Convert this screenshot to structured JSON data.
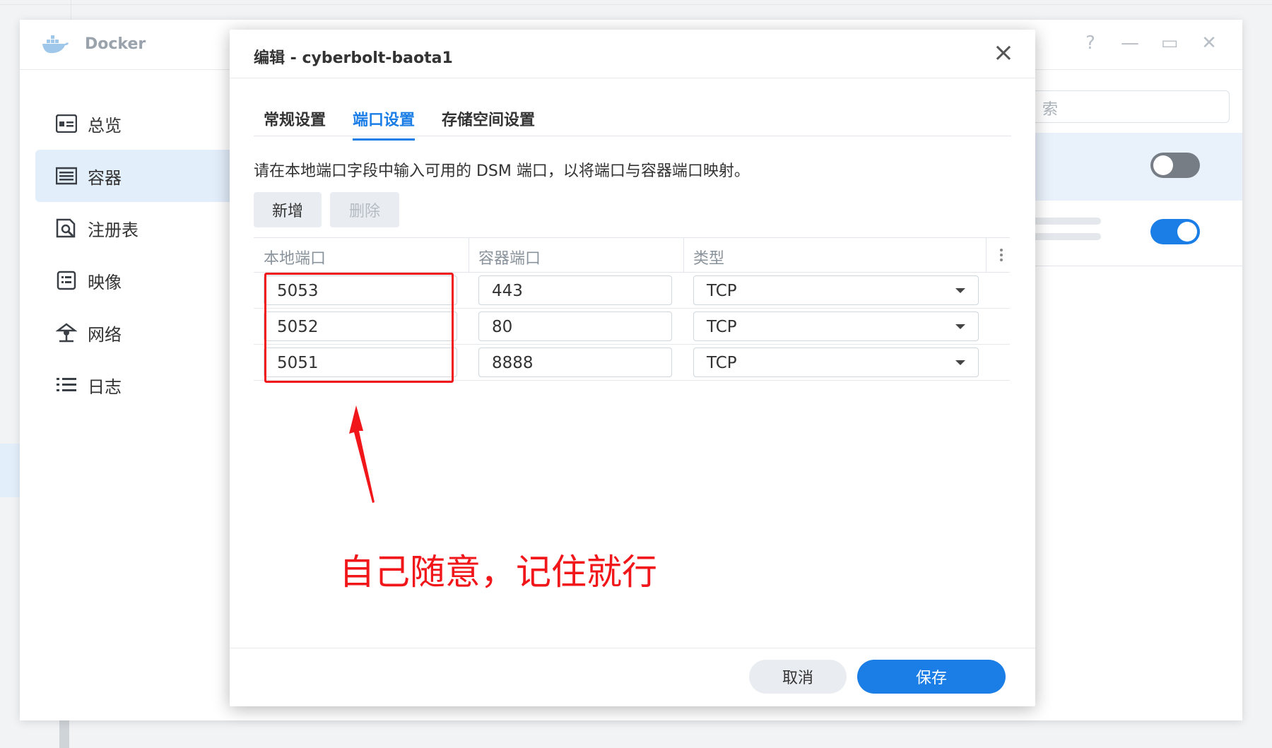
{
  "window": {
    "title": "Docker",
    "controls": {
      "help": "?",
      "minimize": "—",
      "maximize": "▭",
      "close": "✕"
    }
  },
  "sidebar": {
    "items": [
      {
        "label": "总览",
        "icon": "overview-icon",
        "active": false
      },
      {
        "label": "容器",
        "icon": "container-icon",
        "active": true
      },
      {
        "label": "注册表",
        "icon": "registry-icon",
        "active": false
      },
      {
        "label": "映像",
        "icon": "image-icon",
        "active": false
      },
      {
        "label": "网络",
        "icon": "network-icon",
        "active": false
      },
      {
        "label": "日志",
        "icon": "log-icon",
        "active": false
      }
    ]
  },
  "background": {
    "search_placeholder_fragment": "索",
    "toggle_off_color": "#767d85",
    "toggle_on_color": "#1a7ee6"
  },
  "modal": {
    "title": "编辑 - cyberbolt-baota1",
    "tabs": [
      {
        "label": "常规设置",
        "active": false
      },
      {
        "label": "端口设置",
        "active": true
      },
      {
        "label": "存储空间设置",
        "active": false
      }
    ],
    "description": "请在本地端口字段中输入可用的 DSM 端口，以将端口与容器端口映射。",
    "add_label": "新增",
    "delete_label": "删除",
    "table": {
      "headers": [
        "本地端口",
        "容器端口",
        "类型"
      ],
      "rows": [
        {
          "local": "5053",
          "container": "443",
          "type": "TCP"
        },
        {
          "local": "5052",
          "container": "80",
          "type": "TCP"
        },
        {
          "local": "5051",
          "container": "8888",
          "type": "TCP"
        }
      ]
    },
    "cancel_label": "取消",
    "save_label": "保存"
  },
  "annotation": {
    "text": "自己随意，记住就行",
    "color": "#f0161a"
  },
  "accent_color": "#1a7ee6"
}
